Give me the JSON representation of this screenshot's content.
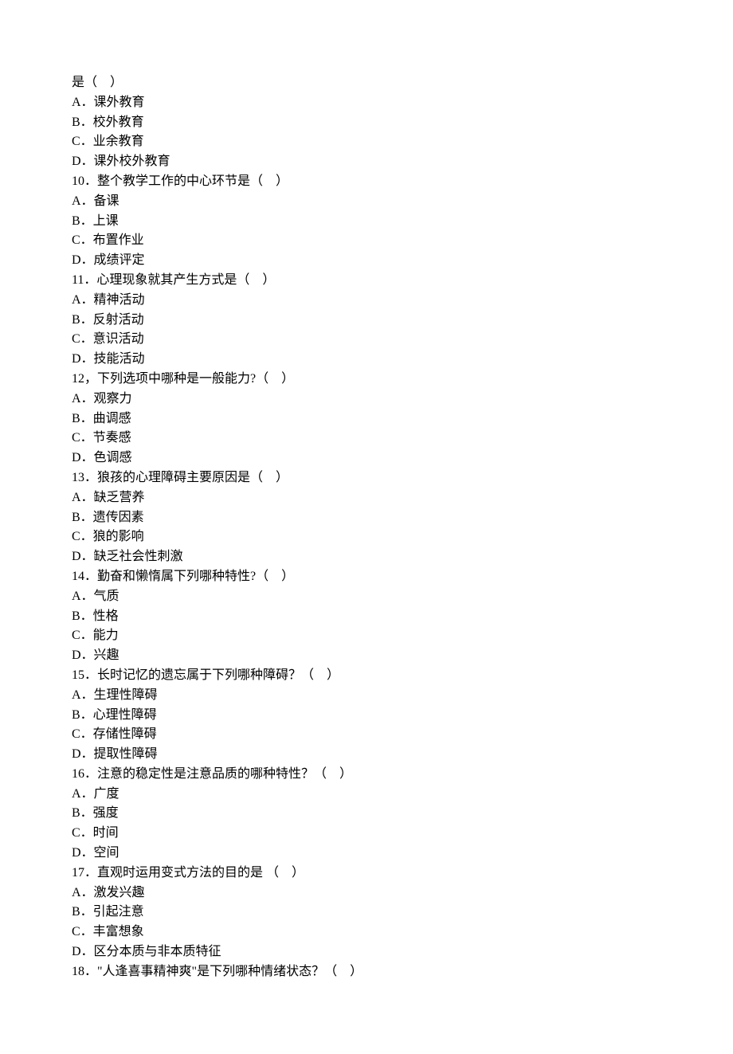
{
  "lines": [
    "是（　）",
    "A．课外教育",
    "B．校外教育",
    "C．业余教育",
    "D．课外校外教育",
    "10．整个教学工作的中心环节是（　）",
    "A．备课",
    "B．上课",
    "C．布置作业",
    "D．成绩评定",
    "11．心理现象就其产生方式是（　）",
    "A．精神活动",
    "B．反射活动",
    "C．意识活动",
    "D．技能活动",
    "12，下列选项中哪种是一般能力?（　）",
    "A．观察力",
    "B．曲调感",
    "C．节奏感",
    "D．色调感",
    "13．狼孩的心理障碍主要原因是（　）",
    "A．缺乏营养",
    "B．遗传因素",
    "C．狼的影响",
    "D．缺乏社会性刺激",
    "14．勤奋和懒惰属下列哪种特性?（　）",
    "A．气质",
    "B．性格",
    "C．能力",
    "D．兴趣",
    "15．长时记忆的遗忘属于下列哪种障碍？（　）",
    "A．生理性障碍",
    "B．心理性障碍",
    "C．存储性障碍",
    "D．提取性障碍",
    "16．注意的稳定性是注意品质的哪种特性？（　）",
    "A．广度",
    "B．强度",
    "C．时间",
    "D．空间",
    "17．直观时运用变式方法的目的是 （　）",
    "A．激发兴趣",
    "B．引起注意",
    "C．丰富想象",
    "D．区分本质与非本质特征",
    "18．\"人逢喜事精神爽\"是下列哪种情绪状态？（　）"
  ]
}
